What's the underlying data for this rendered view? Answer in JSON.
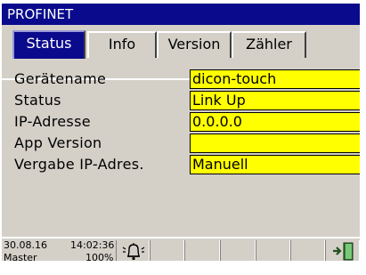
{
  "window": {
    "title": "PROFINET"
  },
  "tabs": [
    {
      "label": "Status",
      "active": true
    },
    {
      "label": "Info",
      "active": false
    },
    {
      "label": "Version",
      "active": false
    },
    {
      "label": "Zähler",
      "active": false
    }
  ],
  "rows": [
    {
      "label": "Gerätename",
      "value": "dicon-touch"
    },
    {
      "label": "Status",
      "value": "Link Up"
    },
    {
      "label": "IP-Adresse",
      "value": "0.0.0.0"
    },
    {
      "label": "App Version",
      "value": ""
    },
    {
      "label": "Vergabe IP-Adres.",
      "value": "Manuell"
    }
  ],
  "statusbar": {
    "date": "30.08.16",
    "time": "14:02:36",
    "user": "Master",
    "brightness": "100%"
  },
  "icons": {
    "alarm": "bell-icon",
    "exit": "exit-door-icon"
  },
  "colors": {
    "titlebar": "#0a0a8c",
    "field": "#ffff00",
    "background": "#d4d0c8"
  }
}
